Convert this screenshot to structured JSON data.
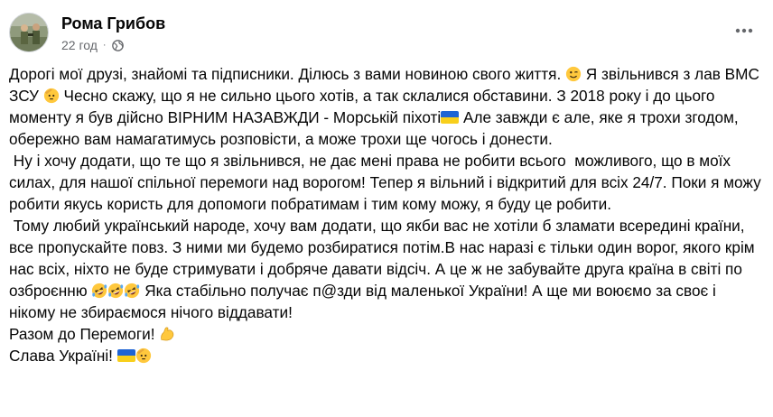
{
  "post": {
    "author": "Рома Грибов",
    "time": "22 год",
    "separator": "·",
    "paragraphs": [
      {
        "segments": [
          {
            "type": "text",
            "value": "Дорогі мої друзі, знайомі та підписники. Ділюсь з вами новиною свого життя. "
          },
          {
            "type": "emoji",
            "name": "winking-face-icon"
          },
          {
            "type": "text",
            "value": " Я звільнився з лав ВМС ЗСУ "
          },
          {
            "type": "emoji",
            "name": "saluting-face-icon"
          },
          {
            "type": "text",
            "value": " Чесно скажу, що я не сильно цього хотів, а так склалися обставини. З 2018 року і до цього моменту я був дійсно ВІРНИМ НАЗАВЖДИ - Морській піхоті"
          },
          {
            "type": "emoji",
            "name": "ukraine-flag-icon"
          },
          {
            "type": "text",
            "value": " Але завжди є але, яке я трохи згодом, обережно вам намагатимусь розповісти, а може трохи ще чогось і донести."
          }
        ]
      },
      {
        "segments": [
          {
            "type": "text",
            "value": " Ну і хочу додати, що те що я звільнився, не дає мені права не робити всього  можливого, що в моїх силах, для нашої спільної перемоги над ворогом! Тепер я вільний і відкритий для всіх 24/7. Поки я можу робити якусь користь для допомоги побратимам і тим кому можу, я буду це робити."
          }
        ]
      },
      {
        "segments": [
          {
            "type": "text",
            "value": " Тому любий український народе, хочу вам додати, що якби вас не хотіли б зламати всередині країни, все пропускайте повз. З ними ми будемо розбиратися потім.В нас наразі є тільки один ворог, якого крім нас всіх, ніхто не буде стримувати і добряче давати відсіч. А це ж не забувайте друга країна в світі по озброєнню "
          },
          {
            "type": "emoji",
            "name": "rofl-face-icon"
          },
          {
            "type": "emoji",
            "name": "rofl-face-icon"
          },
          {
            "type": "emoji",
            "name": "rofl-face-icon"
          },
          {
            "type": "text",
            "value": " Яка стабільно получає п@зди від маленької України! А ще ми воюємо за своє і нікому не збираємося нічого віддавати!"
          }
        ]
      },
      {
        "segments": [
          {
            "type": "text",
            "value": "Разом до Перемоги! "
          },
          {
            "type": "emoji",
            "name": "flexed-biceps-icon"
          }
        ]
      },
      {
        "segments": [
          {
            "type": "text",
            "value": "Слава Україні! "
          },
          {
            "type": "emoji",
            "name": "ukraine-flag-icon"
          },
          {
            "type": "emoji",
            "name": "saluting-face-icon"
          }
        ]
      }
    ]
  },
  "icons": {
    "globe": "globe-icon",
    "more": "more-horizontal-icon"
  },
  "colors": {
    "text": "#050505",
    "secondary": "#65676b",
    "flag_blue": "#1e64d4",
    "flag_yellow": "#f8cf1c",
    "emoji_yellow": "#ffc83d"
  }
}
